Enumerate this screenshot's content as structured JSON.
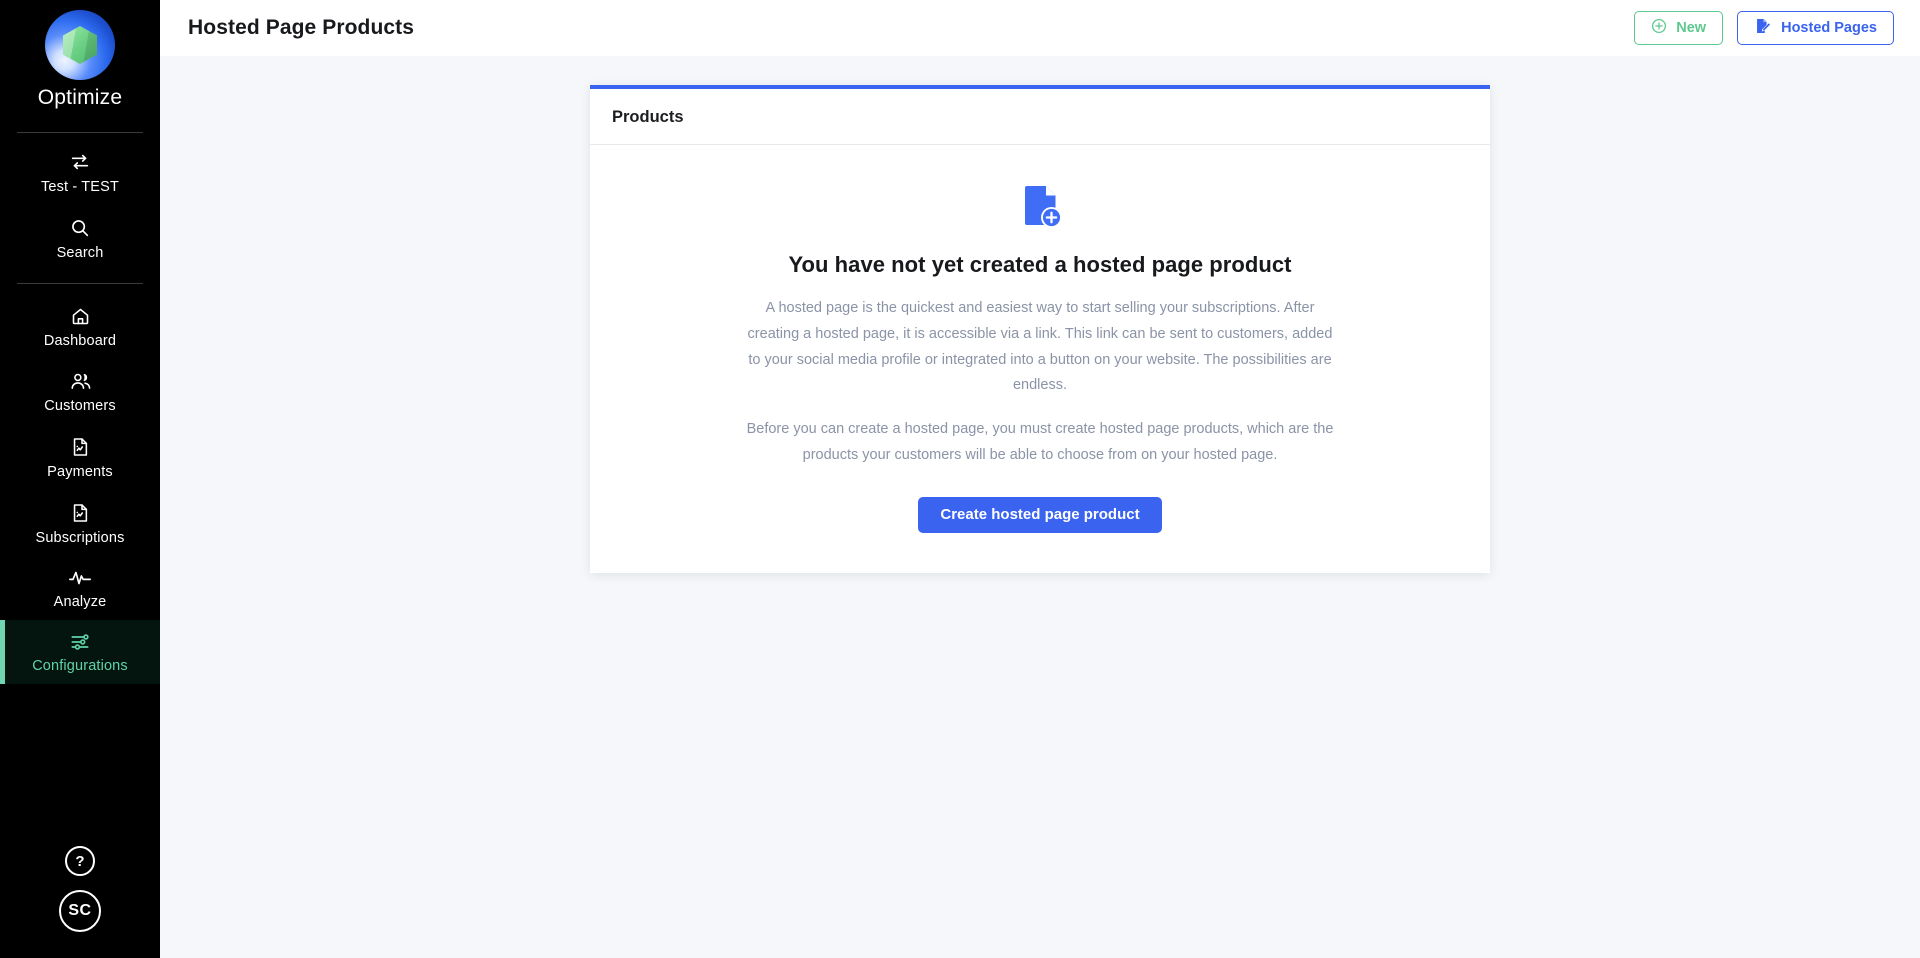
{
  "sidebar": {
    "brand": "Optimize",
    "logo_icon": "optimize-logo",
    "primary_items": [
      {
        "id": "tenant",
        "label": "Test - TEST",
        "icon": "switch-arrows-icon",
        "active": false
      },
      {
        "id": "search",
        "label": "Search",
        "icon": "search-icon",
        "active": false
      }
    ],
    "nav_items": [
      {
        "id": "dashboard",
        "label": "Dashboard",
        "icon": "home-icon",
        "active": false
      },
      {
        "id": "customers",
        "label": "Customers",
        "icon": "users-icon",
        "active": false
      },
      {
        "id": "payments",
        "label": "Payments",
        "icon": "document-chart-icon",
        "active": false
      },
      {
        "id": "subscriptions",
        "label": "Subscriptions",
        "icon": "document-chart-icon",
        "active": false
      },
      {
        "id": "analyze",
        "label": "Analyze",
        "icon": "pulse-icon",
        "active": false
      },
      {
        "id": "configurations",
        "label": "Configurations",
        "icon": "sliders-icon",
        "active": true
      }
    ],
    "bottom": {
      "help_label": "?",
      "help_icon": "question-mark-icon",
      "avatar_initials": "SC",
      "avatar_icon": "avatar"
    },
    "colors": {
      "background": "#000000",
      "active_accent": "#6fd6b0",
      "active_text": "#5fd4a8",
      "active_background": "#041510"
    }
  },
  "header": {
    "title": "Hosted Page Products",
    "buttons": [
      {
        "id": "new",
        "label": "New",
        "icon": "plus-circle-icon",
        "color": "#5ec98e"
      },
      {
        "id": "hosted-pages",
        "label": "Hosted Pages",
        "icon": "document-edit-icon",
        "color": "#3a63f0"
      }
    ]
  },
  "card": {
    "accent_color": "#3a63f0",
    "title": "Products",
    "empty_state": {
      "icon": "document-add-icon",
      "heading": "You have not yet created a hosted page product",
      "paragraph_1": "A hosted page is the quickest and easiest way to start selling your subscriptions. After creating a hosted page, it is accessible via a link. This link can be sent to customers, added to your social media profile or integrated into a button on your website. The possibilities are endless.",
      "paragraph_2": "Before you can create a hosted page, you must create hosted page products, which are the products your customers will be able to choose from on your hosted page.",
      "cta_label": "Create hosted page product"
    }
  }
}
